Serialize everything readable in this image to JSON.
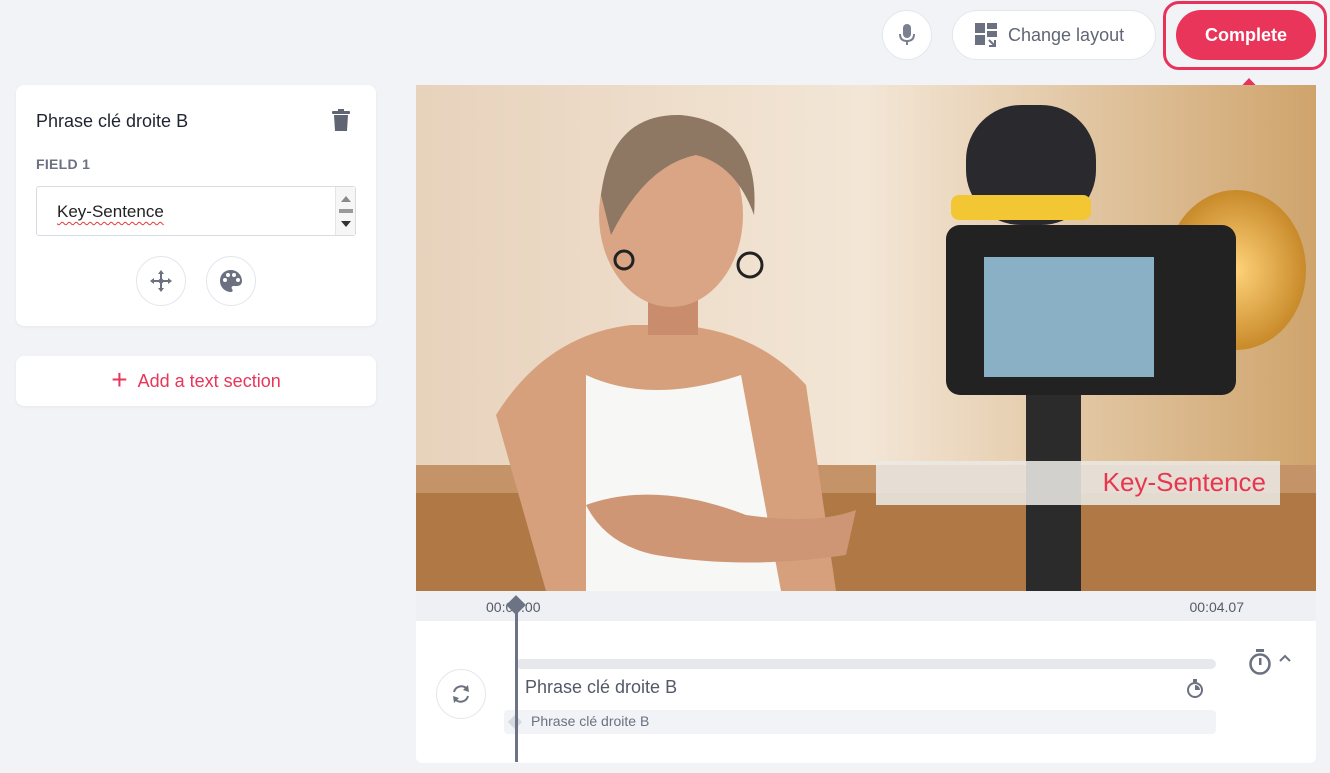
{
  "toolbar": {
    "mic_icon": "microphone-icon",
    "change_layout_label": "Change layout",
    "layout_icon": "layout-grid-icon",
    "complete_label": "Complete"
  },
  "colors": {
    "accent": "#e83559",
    "background": "#f1f3f7",
    "overlay_text": "#e6374f"
  },
  "section_card": {
    "title": "Phrase clé droite B",
    "delete_icon": "trash-icon",
    "field_label": "FIELD 1",
    "field_value": "Key-Sentence",
    "move_icon": "move-icon",
    "palette_icon": "palette-icon"
  },
  "add_section": {
    "label": "Add a text section"
  },
  "video": {
    "overlay_text": "Key-Sentence"
  },
  "timeline": {
    "start_time": "00:00.00",
    "end_time": "00:04.07",
    "track_title": "Phrase clé droite B",
    "clip_label": "Phrase clé droite B",
    "refresh_icon": "refresh-icon",
    "stopwatch_icon": "stopwatch-icon",
    "chevron_icon": "chevron-up-icon"
  }
}
